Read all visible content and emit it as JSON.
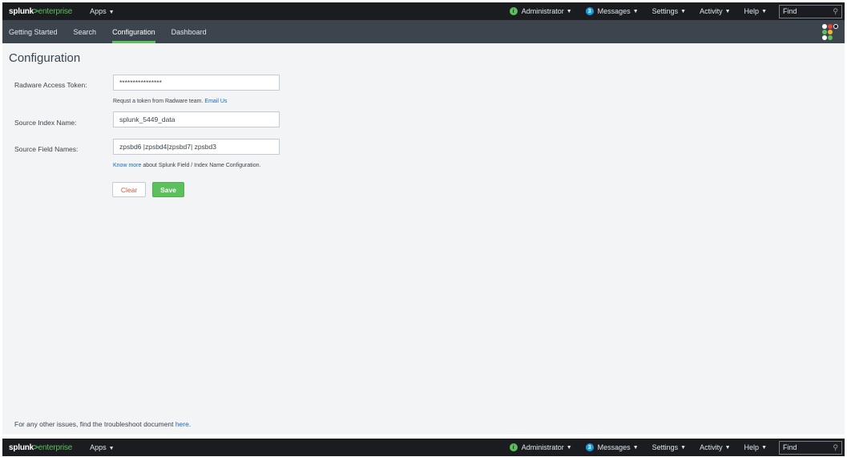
{
  "topbar": {
    "logo_brand": "splunk",
    "logo_sep": ">",
    "logo_product": "enterprise",
    "apps_label": "Apps",
    "admin_label": "Administrator",
    "messages_count": "3",
    "messages_label": "Messages",
    "settings_label": "Settings",
    "activity_label": "Activity",
    "help_label": "Help",
    "find_placeholder": "Find",
    "admin_icon": "i"
  },
  "appbar": {
    "tabs": [
      {
        "label": "Getting Started"
      },
      {
        "label": "Search"
      },
      {
        "label": "Configuration"
      },
      {
        "label": "Dashboard"
      }
    ],
    "active_tab": "Configuration"
  },
  "page": {
    "title": "Configuration",
    "token_label": "Radware Access Token:",
    "token_value": "****************",
    "token_help_text": "Requst a token from Radware team.",
    "token_help_link": "Email Us",
    "index_label": "Source Index Name:",
    "index_value": "splunk_5449_data",
    "fields_label": "Source Field Names:",
    "fields_value": "zpsbd6 |zpsbd4|zpsbd7| zpsbd3",
    "fields_help_link": "Know more",
    "fields_help_text": "about Splunk Field / Index Name Configuration.",
    "clear_label": "Clear",
    "save_label": "Save",
    "footer_text": "For any other issues, find the troubleshoot document",
    "footer_link": "here",
    "footer_end": "."
  },
  "colors": {
    "topbar_bg": "#1a1c20",
    "appbar_bg": "#3c444d",
    "accent_green": "#5cc05c",
    "link_blue": "#1a6bb8",
    "badge_blue": "#1a9ce0",
    "clear_red": "#d6563c",
    "content_bg": "#f2f4f5"
  },
  "icons": {
    "search": "magnifier-icon",
    "app_logo": "app-dots-icon",
    "caret": "caret-down-icon"
  }
}
